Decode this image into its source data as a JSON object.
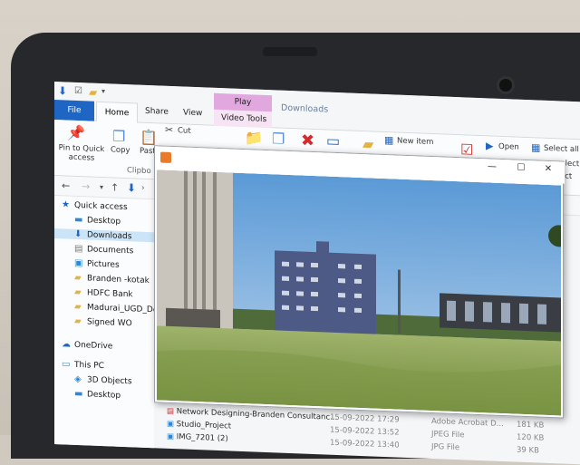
{
  "explorer": {
    "tabs": {
      "file": "File",
      "home": "Home",
      "share": "Share",
      "view": "View",
      "play": "Play",
      "video_tools": "Video Tools",
      "downloads": "Downloads"
    },
    "ribbon": {
      "pin": "Pin to Quick access",
      "copy": "Copy",
      "paste": "Past",
      "cut": "Cut",
      "clipboard": "Clipbo",
      "new_item": "New item",
      "open": "Open",
      "select_all": "Select all",
      "select": "select",
      "invert": "ect"
    },
    "nav": [
      {
        "label": "Quick access",
        "icon": "star-icon"
      },
      {
        "label": "Desktop",
        "icon": "folder-icon"
      },
      {
        "label": "Downloads",
        "icon": "download-icon"
      },
      {
        "label": "Documents",
        "icon": "document-icon"
      },
      {
        "label": "Pictures",
        "icon": "picture-icon"
      },
      {
        "label": "Branden -kotak",
        "icon": "folder-icon"
      },
      {
        "label": "HDFC Bank",
        "icon": "folder-icon"
      },
      {
        "label": "Madurai_UGD_De",
        "icon": "folder-icon"
      },
      {
        "label": "Signed WO",
        "icon": "folder-icon"
      },
      {
        "label": "OneDrive",
        "icon": "cloud-icon"
      },
      {
        "label": "This PC",
        "icon": "computer-icon"
      },
      {
        "label": "3D Objects",
        "icon": "cube-icon"
      },
      {
        "label": "Desktop",
        "icon": "folder-icon"
      }
    ],
    "files": [
      {
        "name": "Network Designing-Branden Consultanc...",
        "date": "15-09-2022 17:29",
        "type": "Adobe Acrobat D...",
        "size": "181 KB"
      },
      {
        "name": "Studio_Project",
        "date": "15-09-2022 13:52",
        "type": "JPEG File",
        "size": "120 KB"
      },
      {
        "name": "IMG_7201 (2)",
        "date": "15-09-2022 13:40",
        "type": "JPG File",
        "size": "39 KB"
      }
    ]
  },
  "viewer": {
    "controls": {
      "minimize": "—",
      "maximize": "☐",
      "close": "✕"
    }
  },
  "colors": {
    "accent": "#1f65c4",
    "play_tab": "#e0a8de",
    "bezel": "#26282b"
  }
}
